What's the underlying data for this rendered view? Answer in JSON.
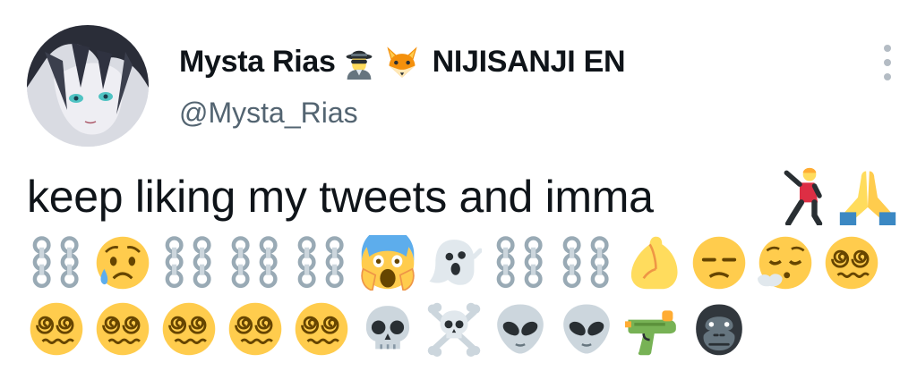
{
  "user": {
    "display_name": "Mysta Rias",
    "affiliation": "NIJISANJI EN",
    "handle": "@Mysta_Rias",
    "badges": [
      "detective-emoji",
      "fox-emoji"
    ]
  },
  "tweet": {
    "text": "keep liking my tweets and imma",
    "inline_emojis": [
      "man-dancing-emoji",
      "folded-hands-emoji"
    ],
    "emoji_row_1": [
      "chains-emoji",
      "sad-relieved-face-emoji",
      "chains-emoji",
      "chains-emoji",
      "chains-emoji",
      "screaming-face-emoji",
      "ghost-emoji",
      "chains-emoji",
      "chains-emoji",
      "pinched-fingers-emoji",
      "unamused-face-emoji",
      "face-exhaling-emoji",
      "dizzy-face-emoji"
    ],
    "emoji_row_2": [
      "dizzy-face-emoji",
      "dizzy-face-emoji",
      "dizzy-face-emoji",
      "dizzy-face-emoji",
      "dizzy-face-emoji",
      "skull-emoji",
      "skull-crossbones-emoji",
      "alien-emoji",
      "alien-emoji",
      "water-pistol-emoji",
      "gorilla-emoji"
    ]
  },
  "colors": {
    "text": "#0f1419",
    "secondary": "#536471",
    "emoji_yellow": "#ffcc4d",
    "emoji_brown": "#664500"
  }
}
